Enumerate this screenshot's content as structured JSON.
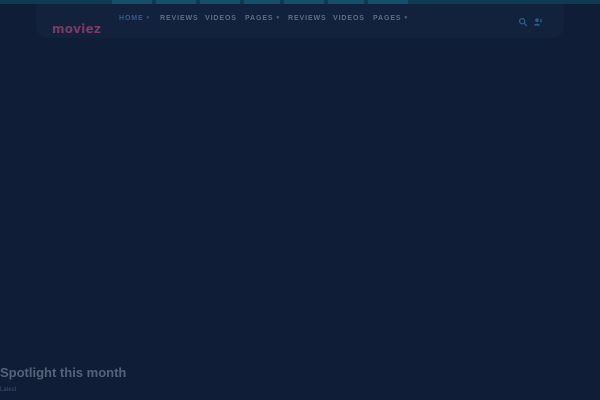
{
  "brand": {
    "logo_text": "moviez",
    "logo_color": "#7a3a64"
  },
  "nav": {
    "items": [
      {
        "label": "HOME",
        "has_caret": true,
        "active": true
      },
      {
        "label": "REVIEWS",
        "has_caret": false,
        "active": false
      },
      {
        "label": "VIDEOS",
        "has_caret": false,
        "active": false
      },
      {
        "label": "PAGES",
        "has_caret": true,
        "active": false
      },
      {
        "label": "REVIEWS",
        "has_caret": false,
        "active": false
      },
      {
        "label": "VIDEOS",
        "has_caret": false,
        "active": false
      },
      {
        "label": "PAGES",
        "has_caret": true,
        "active": false
      }
    ],
    "caret_glyph": "▾",
    "icons": [
      "search-icon",
      "user-icon"
    ]
  },
  "spotlight": {
    "title": "Spotlight this month",
    "subtitle": "Latest"
  },
  "colors": {
    "background": "#0f1d36",
    "header": "#12223d",
    "accent": "#14506b",
    "active_nav": "#2b5f86",
    "nav_text": "#5c6d86"
  }
}
